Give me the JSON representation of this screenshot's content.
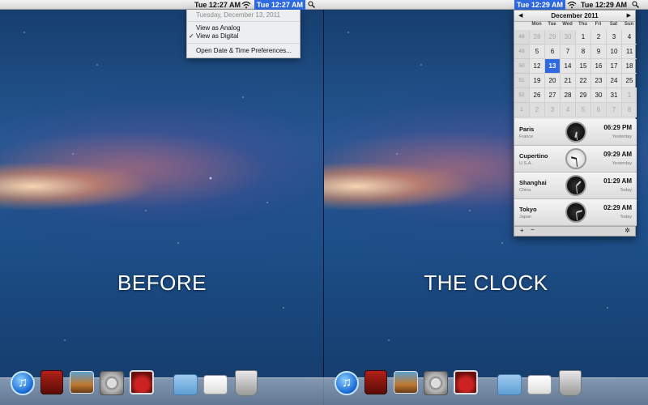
{
  "left_panel": {
    "menubar": {
      "clock_plain": "Tue 12:27 AM",
      "clock_active": "Tue 12:27 AM",
      "wifi_icon": "wifi-icon",
      "search_icon": "spotlight-icon"
    },
    "dropdown": {
      "date": "Tuesday, December 13, 2011",
      "view_analog": "View as Analog",
      "view_digital": "View as Digital",
      "checkmark": "✓",
      "preferences": "Open Date & Time Preferences..."
    },
    "caption": "BEFORE"
  },
  "right_panel": {
    "menubar": {
      "clock_active": "Tue 12:29 AM",
      "clock_plain": "Tue 12:29 AM",
      "wifi_icon": "wifi-icon",
      "search_icon": "spotlight-icon"
    },
    "caption": "THE CLOCK",
    "calendar": {
      "title": "December 2011",
      "prev": "◀",
      "next": "▶",
      "weekdays": [
        "Mon",
        "Tue",
        "Wed",
        "Thu",
        "Fri",
        "Sat",
        "Sun"
      ],
      "weeks": [
        {
          "wk": "48",
          "days": [
            {
              "d": "28",
              "off": true
            },
            {
              "d": "29",
              "off": true
            },
            {
              "d": "30",
              "off": true
            },
            {
              "d": "1"
            },
            {
              "d": "2"
            },
            {
              "d": "3"
            },
            {
              "d": "4"
            }
          ]
        },
        {
          "wk": "49",
          "days": [
            {
              "d": "5"
            },
            {
              "d": "6"
            },
            {
              "d": "7"
            },
            {
              "d": "8"
            },
            {
              "d": "9"
            },
            {
              "d": "10"
            },
            {
              "d": "11"
            }
          ]
        },
        {
          "wk": "50",
          "days": [
            {
              "d": "12"
            },
            {
              "d": "13",
              "today": true
            },
            {
              "d": "14"
            },
            {
              "d": "15"
            },
            {
              "d": "16"
            },
            {
              "d": "17"
            },
            {
              "d": "18"
            }
          ]
        },
        {
          "wk": "51",
          "days": [
            {
              "d": "19"
            },
            {
              "d": "20"
            },
            {
              "d": "21"
            },
            {
              "d": "22"
            },
            {
              "d": "23"
            },
            {
              "d": "24"
            },
            {
              "d": "25"
            }
          ]
        },
        {
          "wk": "52",
          "days": [
            {
              "d": "26"
            },
            {
              "d": "27"
            },
            {
              "d": "28"
            },
            {
              "d": "29"
            },
            {
              "d": "30"
            },
            {
              "d": "31"
            },
            {
              "d": "1",
              "off": true
            }
          ]
        },
        {
          "wk": "1",
          "days": [
            {
              "d": "2",
              "off": true
            },
            {
              "d": "3",
              "off": true
            },
            {
              "d": "4",
              "off": true
            },
            {
              "d": "5",
              "off": true
            },
            {
              "d": "6",
              "off": true
            },
            {
              "d": "7",
              "off": true
            },
            {
              "d": "8",
              "off": true
            }
          ]
        }
      ],
      "cities": [
        {
          "name": "Paris",
          "country": "France",
          "time": "06:29 PM",
          "day": "Yesterday",
          "clock_style": "dark"
        },
        {
          "name": "Cupertino",
          "country": "U.S.A.",
          "time": "09:29 AM",
          "day": "Yesterday",
          "clock_style": "light"
        },
        {
          "name": "Shanghai",
          "country": "China",
          "time": "01:29 AM",
          "day": "Today",
          "clock_style": "dark"
        },
        {
          "name": "Tokyo",
          "country": "Japan",
          "time": "02:29 AM",
          "day": "Today",
          "clock_style": "dark"
        }
      ],
      "footer": {
        "add": "+",
        "remove": "−",
        "gear": "✲"
      }
    }
  },
  "dock": {
    "icons": [
      "itunes-icon",
      "photo-booth-icon",
      "iphoto-icon",
      "system-preferences-icon",
      "time-machine-icon",
      "applications-folder-icon",
      "documents-stack-icon",
      "trash-icon"
    ]
  }
}
